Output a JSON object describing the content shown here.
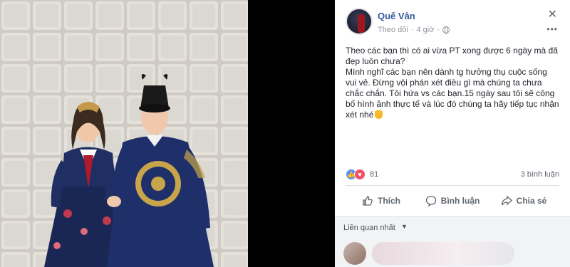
{
  "post": {
    "author": "Quế Vân",
    "follow_label": "Theo dõi",
    "separator": "·",
    "time": "4 giờ",
    "close_glyph": "✕",
    "more_glyph": "•••",
    "body": [
      "Theo các bạn thì có ai vừa PT xong được 6 ngày mà đã đẹp luôn chưa?",
      "Mình nghĩ các bạn nên dành tg hưởng thụ cuộc sống vui vẻ. Đừng vội phán xét điều gì mà chúng ta chưa chắc chắn. Tôi hứa vs các bạn.15 ngày sau tôi sẽ công bố hình ảnh thực tế và lúc đó chúng ta hãy tiếp tục nhận xét nhé"
    ],
    "reactions": {
      "count": "81",
      "comments": "3 bình luận"
    },
    "actions": {
      "like": "Thích",
      "comment": "Bình luận",
      "share": "Chia sẻ"
    },
    "related_label": "Liên quan nhất",
    "related_caret": "▼"
  },
  "colors": {
    "link_blue": "#365899",
    "meta_gray": "#90949c",
    "like_blue": "#5890ff",
    "love_red": "#f25268",
    "background": "#000000"
  },
  "icons": {
    "globe": "globe-icon",
    "close": "close-icon",
    "more": "more-options-icon",
    "like": "thumbs-up-icon",
    "comment": "comment-bubble-icon",
    "share": "share-arrow-icon",
    "emoji": "hand-emoji-icon"
  }
}
